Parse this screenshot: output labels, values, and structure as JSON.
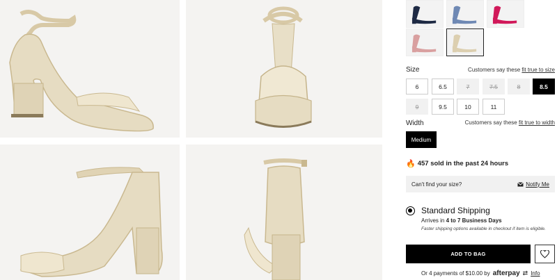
{
  "images": {
    "main": [
      "side-view",
      "front-view",
      "three-quarter-view",
      "back-view"
    ]
  },
  "swatches": [
    {
      "color": "#1e2a44",
      "name": "navy"
    },
    {
      "color": "#6f89b4",
      "name": "blue"
    },
    {
      "color": "#d1195a",
      "name": "pink"
    },
    {
      "color": "#d9a0a0",
      "name": "blush"
    },
    {
      "color": "#dccfb0",
      "name": "gold",
      "selected": true
    }
  ],
  "size": {
    "label": "Size",
    "fit_prefix": "Customers say these ",
    "fit_link": "fit true to size",
    "options": [
      {
        "label": "6",
        "state": "available"
      },
      {
        "label": "6.5",
        "state": "available"
      },
      {
        "label": "7",
        "state": "unavailable"
      },
      {
        "label": "7.5",
        "state": "unavailable"
      },
      {
        "label": "8",
        "state": "unavailable"
      },
      {
        "label": "8.5",
        "state": "selected"
      },
      {
        "label": "9",
        "state": "unavailable"
      },
      {
        "label": "9.5",
        "state": "available"
      },
      {
        "label": "10",
        "state": "available"
      },
      {
        "label": "11",
        "state": "available"
      }
    ]
  },
  "width": {
    "label": "Width",
    "fit_prefix": "Customers say these ",
    "fit_link": "fit true to width",
    "selected": "Medium"
  },
  "sold": {
    "text": "457 sold in the past 24 hours"
  },
  "find": {
    "question": "Can't find your size?",
    "notify": "Notify Me"
  },
  "shipping": {
    "title": "Standard Shipping",
    "arrives_prefix": "Arrives in ",
    "arrives_value": "4 to 7 Business Days",
    "note": "Faster shipping options available in checkout if item is eligible."
  },
  "cta": {
    "add_to_bag": "ADD TO BAG"
  },
  "payment": {
    "text": "Or 4 payments of $10.00 by",
    "brand": "afterpay",
    "info": "Info"
  },
  "colors": {
    "accent": "#000000",
    "sandal": "#dccfb0",
    "bg_image": "#f3f3f3"
  }
}
